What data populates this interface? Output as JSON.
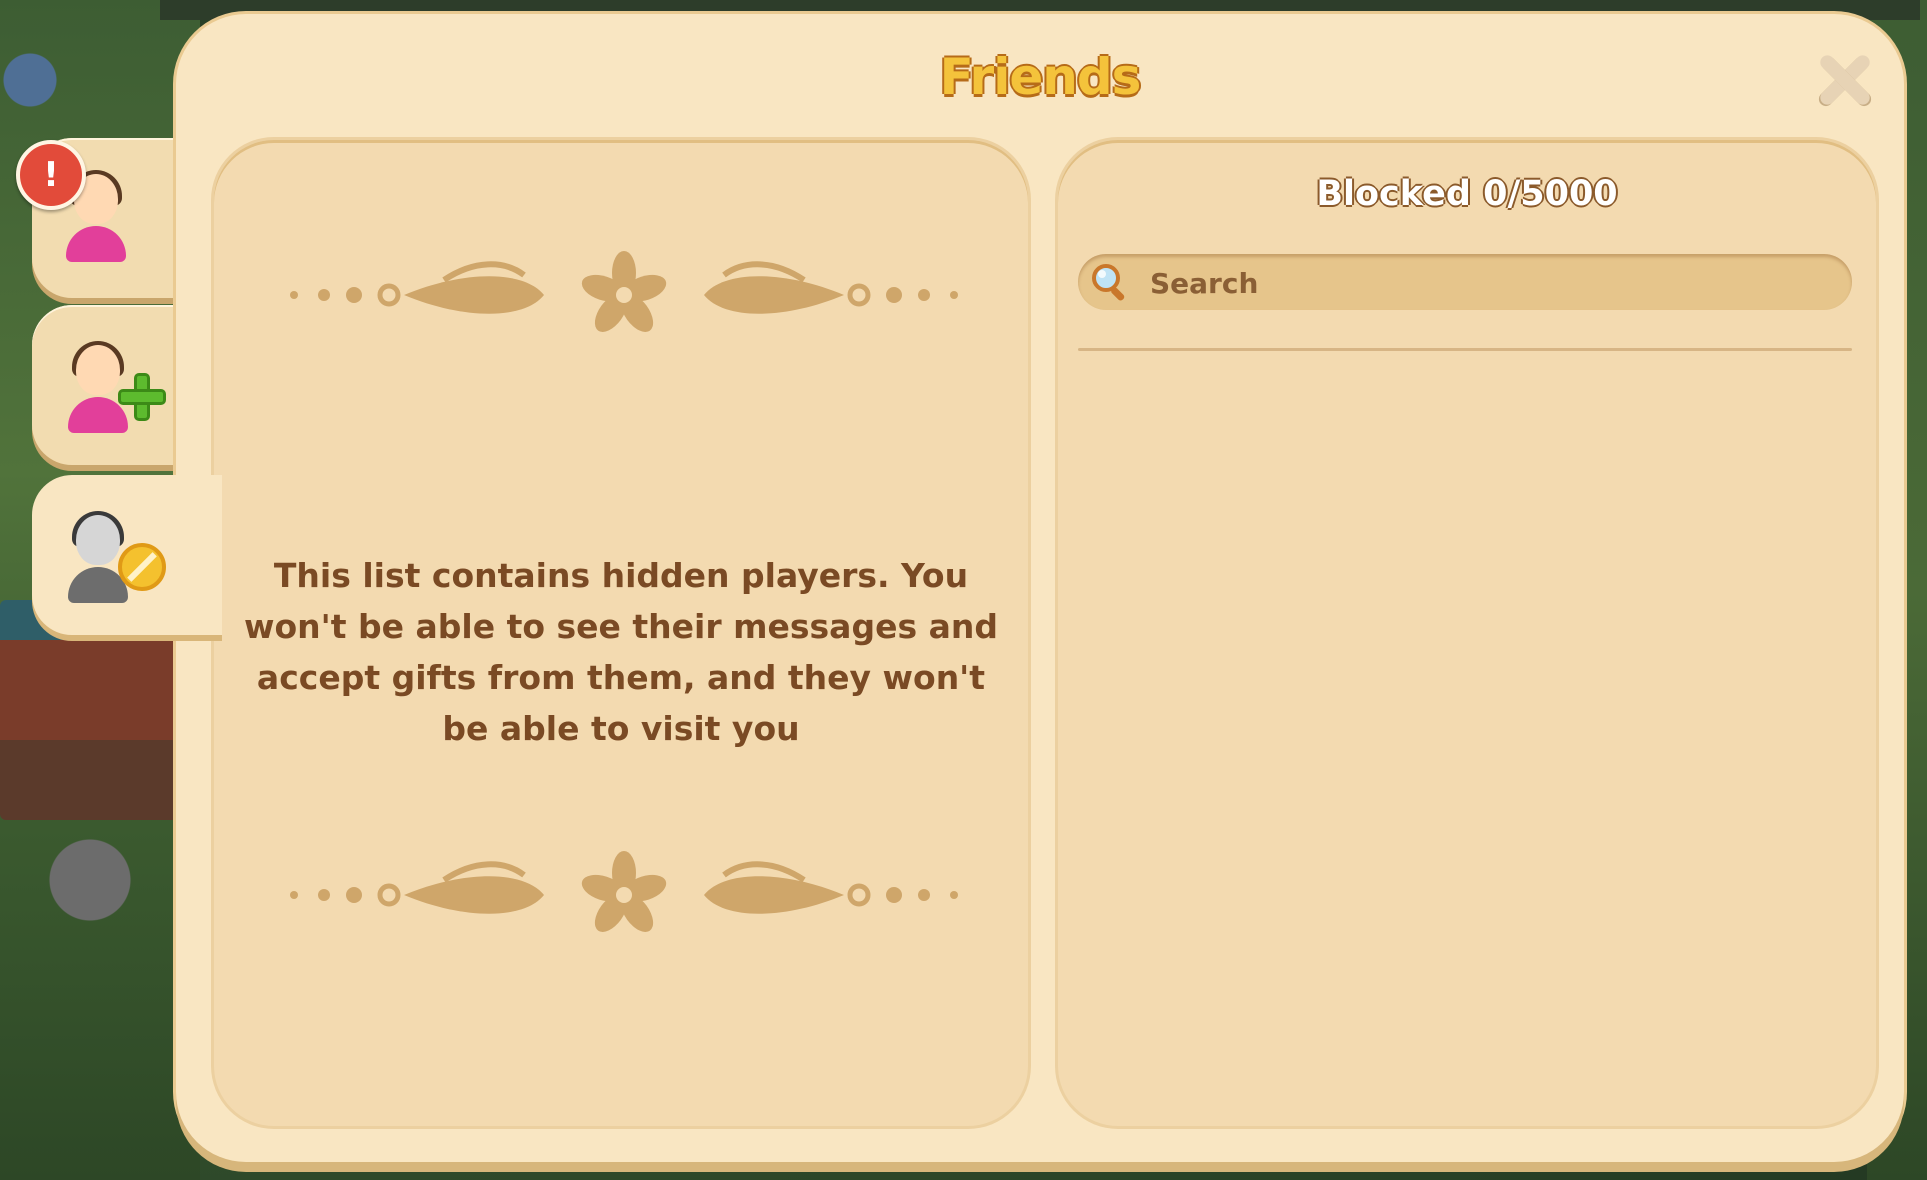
{
  "dialog": {
    "title": "Friends",
    "close_icon": "close-icon"
  },
  "tabs": [
    {
      "name": "friends",
      "icon": "friends-icon",
      "alert": "!",
      "active": false
    },
    {
      "name": "add-friend",
      "icon": "add-friend-icon",
      "active": false
    },
    {
      "name": "blocked",
      "icon": "blocked-player-icon",
      "active": true
    }
  ],
  "left_panel": {
    "info_text": "This list contains hidden players. You won't be able to see their messages and accept gifts from them, and they won't be able to visit you"
  },
  "right_panel": {
    "title": "Blocked 0/5000",
    "search": {
      "placeholder": "Search",
      "value": "",
      "icon": "magnifier-icon"
    }
  },
  "colors": {
    "panel_bg": "#f9e6c2",
    "inner_bg": "#f3dab0",
    "title_yellow": "#f4c33b",
    "text_brown": "#7a4a24",
    "alert_red": "#e24b3a",
    "plus_green": "#5dbb2e",
    "block_yellow": "#f4c12e"
  }
}
